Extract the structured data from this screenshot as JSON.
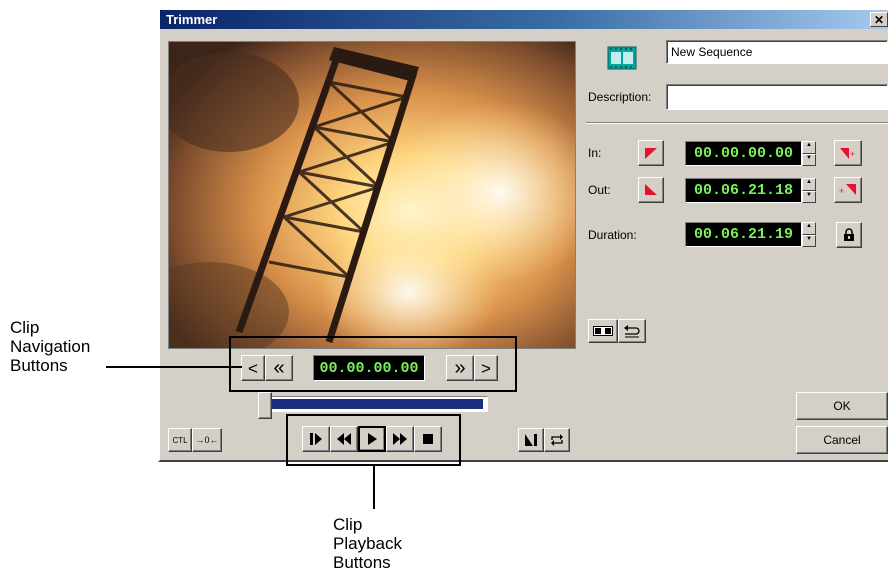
{
  "window": {
    "title": "Trimmer",
    "close_glyph": "✕"
  },
  "sequence": {
    "name": "New Sequence",
    "description_label": "Description:",
    "description_value": "",
    "film_icon": "film-strip-icon"
  },
  "timecodes": {
    "in_label": "In:",
    "in_value": "00.00.00.00",
    "out_label": "Out:",
    "out_value": "00.06.21.18",
    "duration_label": "Duration:",
    "duration_value": "00.06.21.19"
  },
  "navigation": {
    "current_time": "00.00.00.00",
    "prev_frame": "<",
    "rewind": "«",
    "fast_forward": "»",
    "next_frame": ">"
  },
  "buttons": {
    "ok": "OK",
    "cancel": "Cancel",
    "ctl": "CTL",
    "goto_zero": "→0←"
  },
  "scrubber": {
    "progress": 0.0
  },
  "annotations": {
    "nav_lines": [
      "Clip",
      "Navigation",
      "Buttons"
    ],
    "playback_lines": [
      "Clip",
      "Playback",
      "Buttons"
    ]
  },
  "colors": {
    "title_bar": "#0a246a",
    "lcd_text": "#7cf05a",
    "marker_red": "#e8112d",
    "scrubber_fill": "#1b2f7e"
  }
}
